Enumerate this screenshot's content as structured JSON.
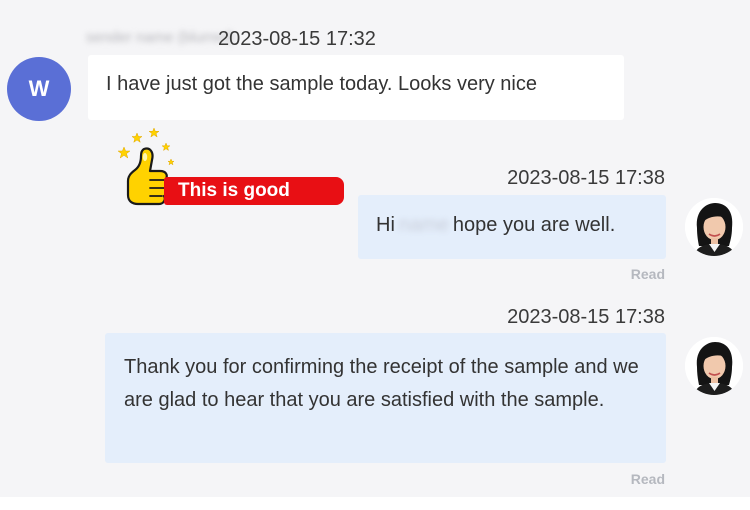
{
  "conversation": {
    "messages": [
      {
        "direction": "incoming",
        "sender_initial": "W",
        "sender_name": "sender name (blurred)",
        "timestamp": "2023-08-15 17:32",
        "text": "I have just got the sample today. Looks very nice"
      },
      {
        "direction": "outgoing",
        "timestamp": "2023-08-15 17:38",
        "text_before": "Hi",
        "blurred_name": "name",
        "text_after": "hope you are well.",
        "status": "Read"
      },
      {
        "direction": "outgoing",
        "timestamp": "2023-08-15 17:38",
        "text": "Thank you for confirming the receipt of the sample and we are glad to hear that you are satisfied with the sample.",
        "status": "Read"
      }
    ]
  },
  "sticker": {
    "icon": "thumbs-up-icon",
    "label": "This is good",
    "colors": {
      "banner": "#e80f14",
      "thumb": "#ffd200"
    }
  },
  "colors": {
    "background": "#f5f5f7",
    "incoming_bubble": "#ffffff",
    "outgoing_bubble": "#e4eefb",
    "avatar": "#5a6fd6",
    "read_status": "#b5b8bf"
  }
}
